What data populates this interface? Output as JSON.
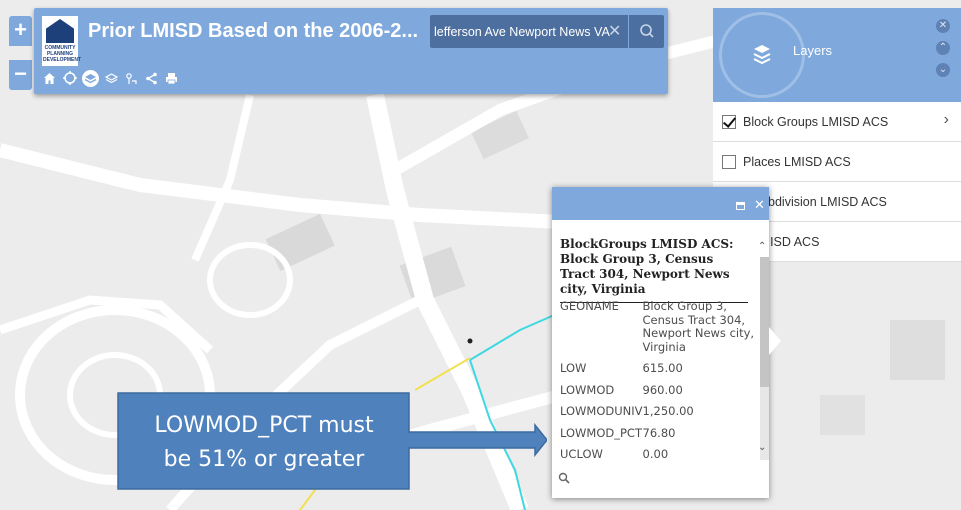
{
  "header": {
    "title": "Prior LMISD Based on the 2006-2...",
    "logo_text": "COMMUNITY PLANNING DEVELOPMENT",
    "search_value": "lefferson Ave Newport News VA",
    "accent_color": "#7fa8dc"
  },
  "zoom": {
    "in_label": "+",
    "out_label": "−"
  },
  "toolbar": {
    "icons": [
      "home-icon",
      "locate-icon",
      "layers-icon",
      "basemap-icon",
      "legend-icon",
      "share-icon",
      "print-icon"
    ]
  },
  "layers": {
    "title": "Layers",
    "items": [
      {
        "label": "Block Groups LMISD ACS",
        "checked": true
      },
      {
        "label": "Places LMISD ACS",
        "checked": false
      },
      {
        "label": "y Subdivision LMISD ACS",
        "checked": false
      },
      {
        "label": "y LMISD ACS",
        "checked": false
      }
    ]
  },
  "popup": {
    "title": "BlockGroups LMISD ACS: Block Group 3, Census Tract 304, Newport News city, Virginia",
    "fields": [
      {
        "key": "GEONAME",
        "value": "Block Group 3, Census Tract 304, Newport News city, Virginia"
      },
      {
        "key": "LOW",
        "value": "615.00"
      },
      {
        "key": "LOWMOD",
        "value": "960.00"
      },
      {
        "key": "LOWMODUNIV",
        "value": "1,250.00"
      },
      {
        "key": "LOWMOD_PCT",
        "value": "76.80"
      },
      {
        "key": "UCLOW",
        "value": "0.00"
      }
    ]
  },
  "callout": {
    "line1": "LOWMOD_PCT must",
    "line2": "be 51% or greater",
    "color": "#4f81bd"
  }
}
